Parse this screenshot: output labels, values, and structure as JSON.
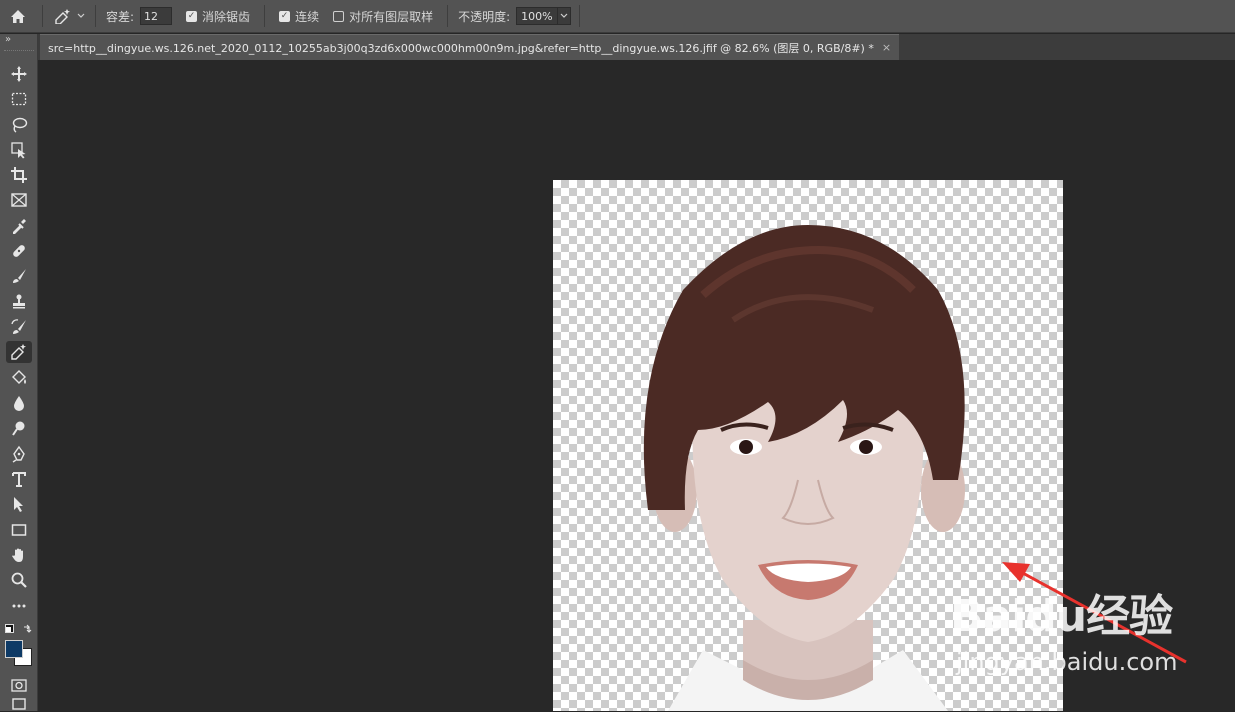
{
  "options_bar": {
    "tolerance_label": "容差:",
    "tolerance_value": "12",
    "antialias_label": "消除锯齿",
    "antialias_checked": true,
    "contiguous_label": "连续",
    "contiguous_checked": true,
    "sample_all_layers_label": "对所有图层取样",
    "sample_all_layers_checked": false,
    "opacity_label": "不透明度:",
    "opacity_value": "100%"
  },
  "document_tab": {
    "title": "src=http__dingyue.ws.126.net_2020_0112_10255ab3j00q3zd6x000wc000hm00n9m.jpg&refer=http__dingyue.ws.126.jfif @ 82.6% (图层 0, RGB/8#) *",
    "close": "×"
  },
  "toolbar": {
    "tools": [
      "move-icon",
      "marquee-icon",
      "lasso-icon",
      "object-select-icon",
      "crop-icon",
      "frame-icon",
      "eyedropper-icon",
      "healing-brush-icon",
      "brush-icon",
      "clone-stamp-icon",
      "history-brush-icon",
      "magic-eraser-icon",
      "paint-bucket-icon",
      "blur-icon",
      "dodge-icon",
      "pen-icon",
      "type-icon",
      "path-select-icon",
      "rectangle-icon",
      "hand-icon",
      "zoom-icon",
      "more-tools-icon"
    ],
    "active_tool": "magic-eraser-icon",
    "foreground_color": "#0e3a66",
    "background_color": "#ffffff"
  },
  "watermark": {
    "brand": "Baidu经验",
    "url": "jingyan.baidu.com"
  },
  "annotation_arrow_color": "#e8322d"
}
